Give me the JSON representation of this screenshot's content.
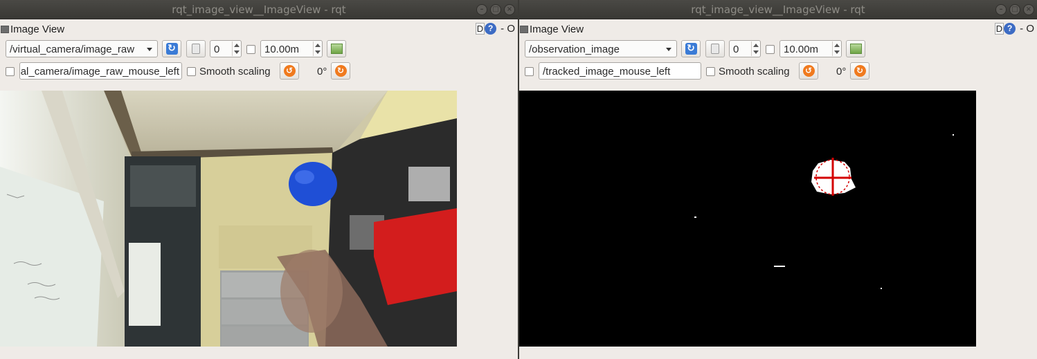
{
  "windows": [
    {
      "title": "rqt_image_view__ImageView - rqt",
      "dock_title": "Image View",
      "dock_badge": "D",
      "dock_help": "?",
      "dock_extra": "- O",
      "topic": "/virtual_camera/image_raw",
      "zoom_value": "0",
      "max_range": "10.00m",
      "mouse_topic": "al_camera/image_raw_mouse_left",
      "smooth_label": "Smooth scaling",
      "rotation": "0°"
    },
    {
      "title": "rqt_image_view__ImageView - rqt",
      "dock_title": "Image View",
      "dock_badge": "D",
      "dock_help": "?",
      "dock_extra": "- O",
      "topic": "/observation_image",
      "zoom_value": "0",
      "max_range": "10.00m",
      "mouse_topic": "/tracked_image_mouse_left",
      "smooth_label": "Smooth scaling",
      "rotation": "0°"
    }
  ],
  "icons": {
    "refresh": "refresh-icon",
    "zoom": "zoom-icon",
    "save": "save-icon",
    "rotate_left": "rotate-left-icon",
    "rotate_right": "rotate-right-icon"
  },
  "colors": {
    "tracking_cross": "#d40000",
    "refresh_blue": "#3a7bd6",
    "rotate_orange": "#f07a1e"
  }
}
